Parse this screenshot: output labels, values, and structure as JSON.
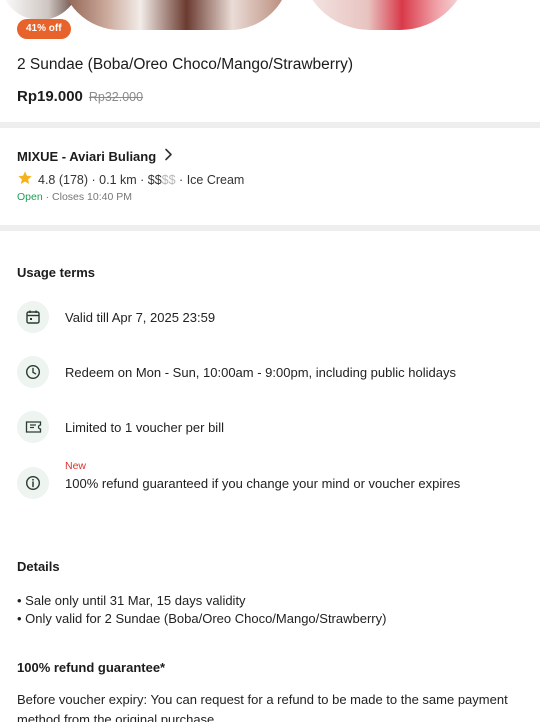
{
  "product": {
    "discount_badge": "41% off",
    "title": "2 Sundae (Boba/Oreo Choco/Mango/Strawberry)",
    "price": "Rp19.000",
    "original_price": "Rp32.000"
  },
  "merchant": {
    "name": "MIXUE - Aviari Buliang",
    "rating": "4.8 (178)",
    "distance": "0.1 km",
    "price_level_active": "$$",
    "price_level_inactive": "$$",
    "category": "Ice Cream",
    "status": "Open",
    "closing": "Closes 10:40 PM",
    "icons": {
      "rating": "star-icon",
      "link": "chevron-right-icon"
    },
    "colors": {
      "star": "#f6b21b",
      "open": "#1f9d55"
    }
  },
  "usage_terms": {
    "title": "Usage terms",
    "items": [
      {
        "icon": "calendar-icon",
        "text": "Valid till Apr 7, 2025 23:59"
      },
      {
        "icon": "clock-icon",
        "text": "Redeem on Mon - Sun, 10:00am - 9:00pm, including public holidays"
      },
      {
        "icon": "voucher-icon",
        "text": "Limited to 1 voucher per bill"
      },
      {
        "icon": "info-icon",
        "text": "100% refund guaranteed if you change your mind or voucher expires",
        "tag": "New"
      }
    ]
  },
  "details": {
    "title": "Details",
    "lines": [
      "• Sale only until 31 Mar, 15 days validity",
      "• Only valid for 2 Sundae (Boba/Oreo Choco/Mango/Strawberry)"
    ]
  },
  "refund": {
    "title": "100% refund guarantee*",
    "text": "Before voucher expiry: You can request for a refund to be made to the same payment method from the original purchase"
  },
  "colors": {
    "accent": "#e8622b",
    "separator": "#eeeeee",
    "new_tag": "#d9342b"
  }
}
